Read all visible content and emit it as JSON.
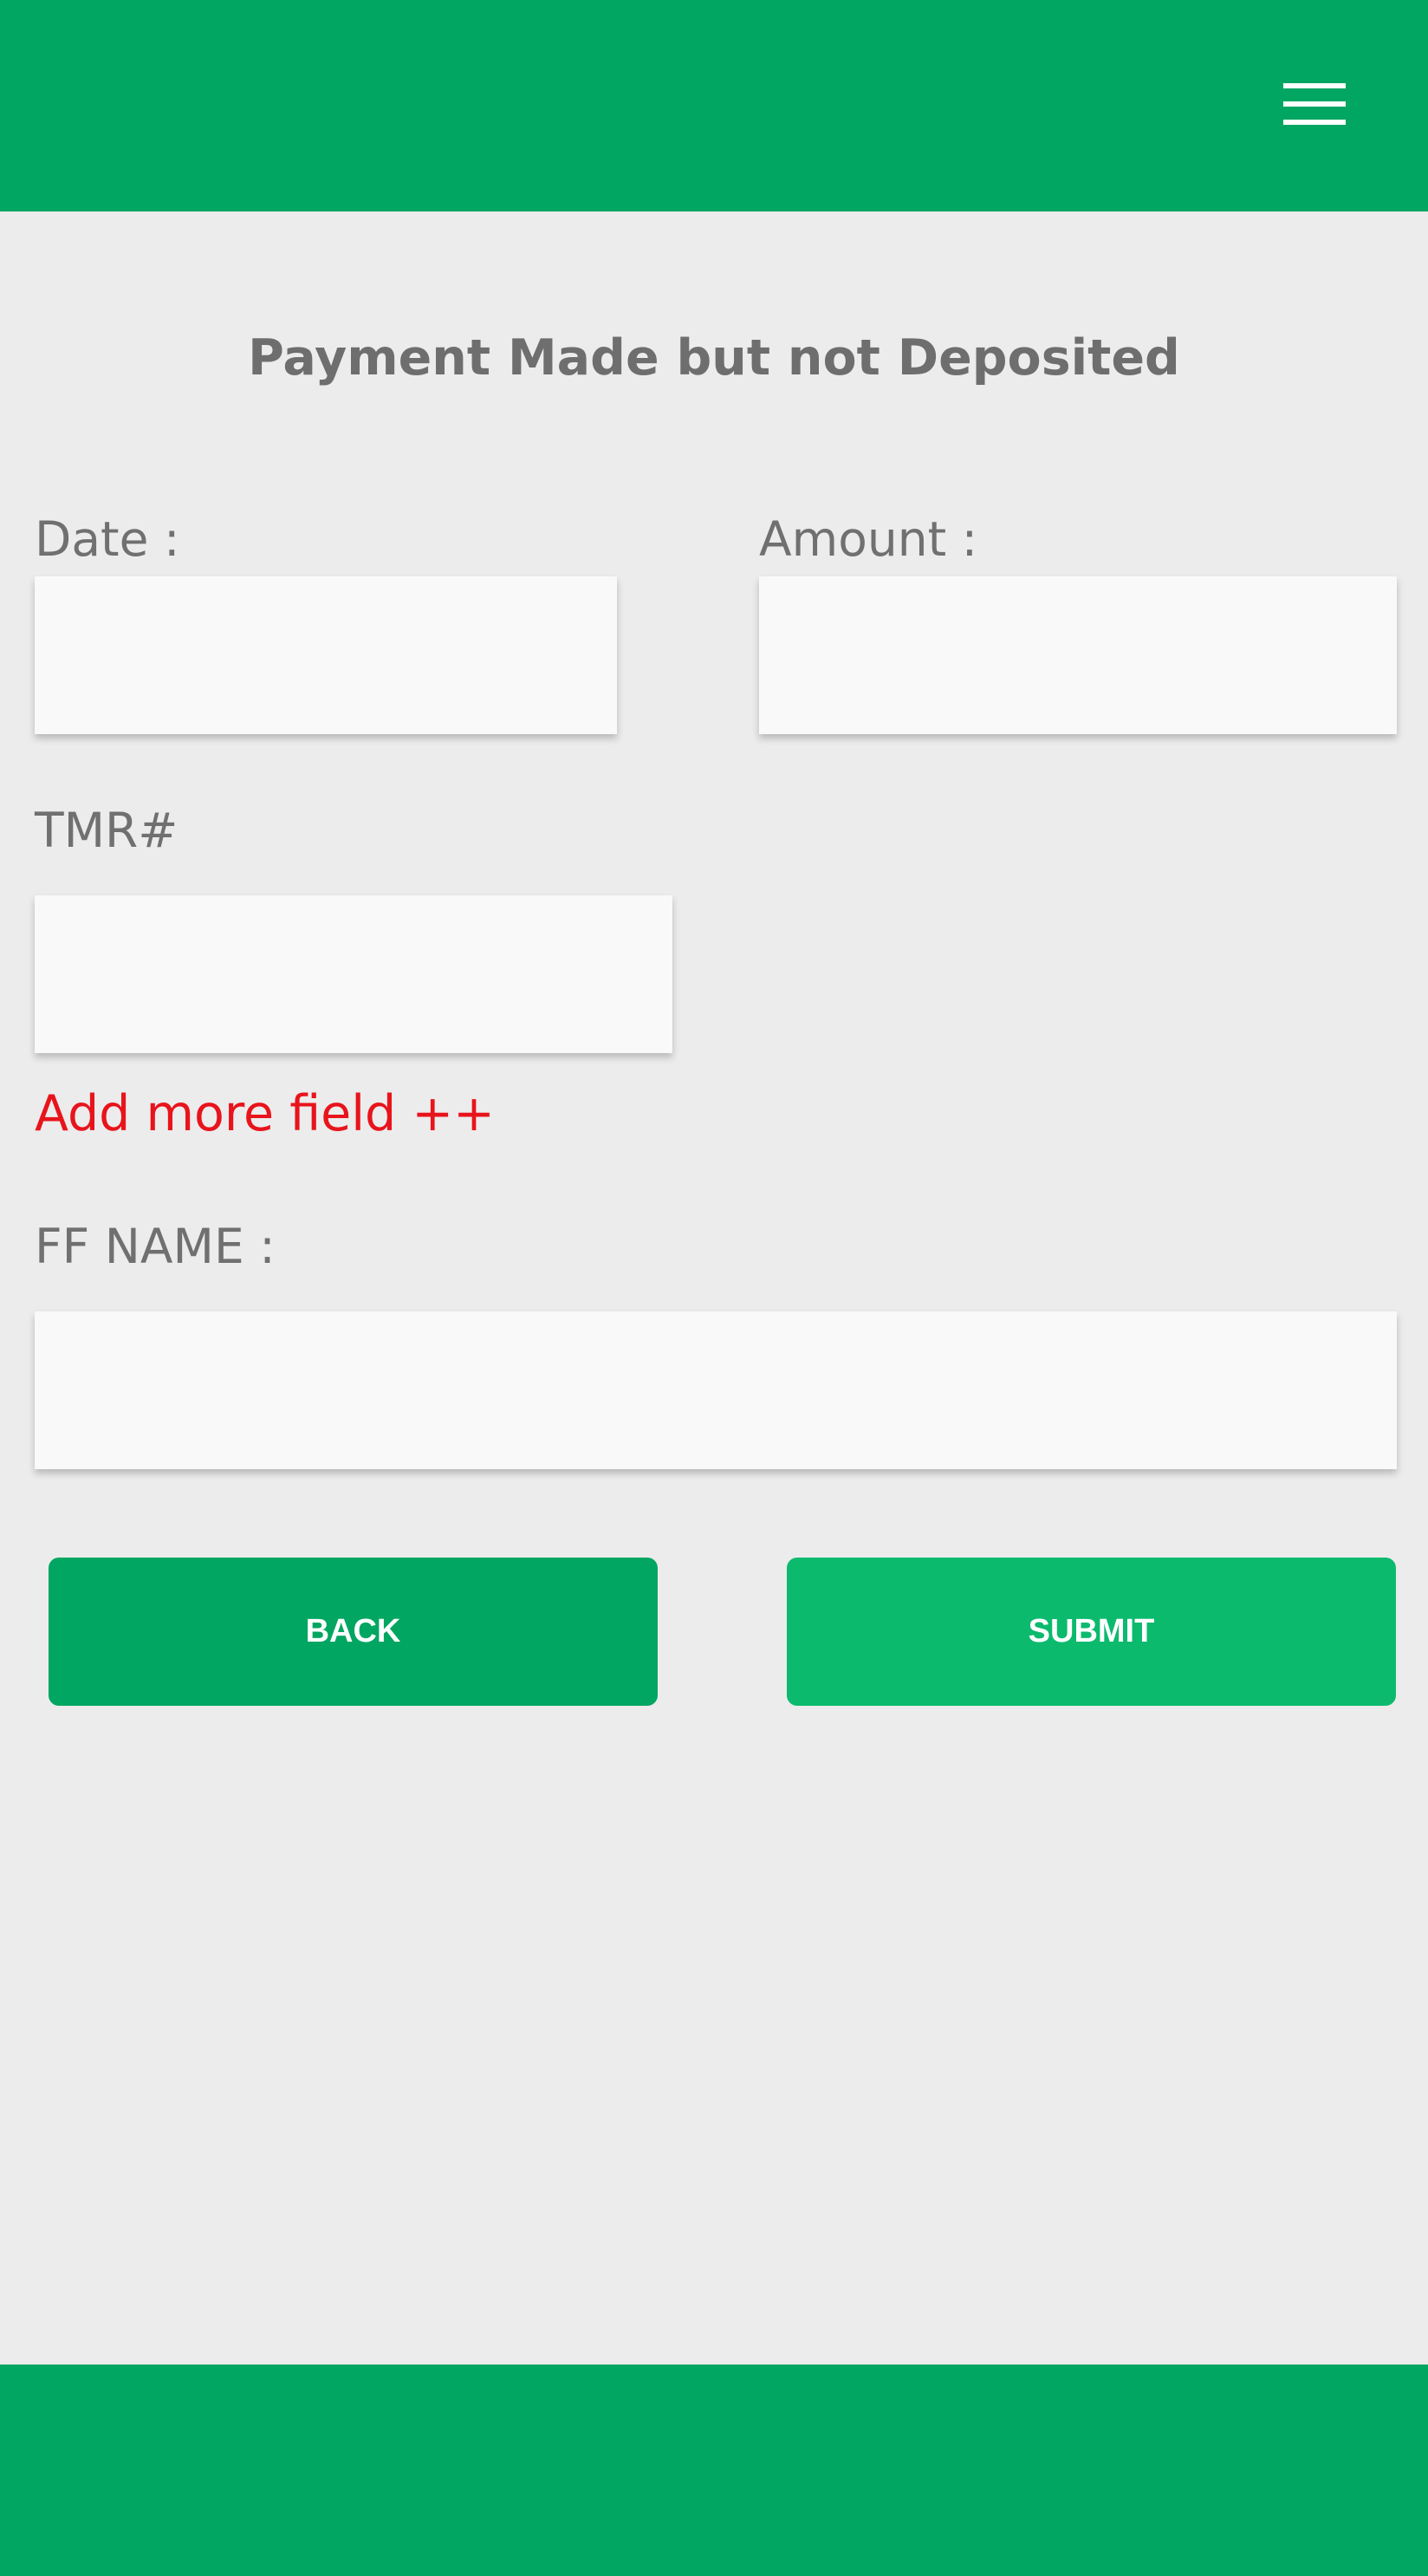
{
  "colors": {
    "primary": "#00a661",
    "submit": "#0cba6e",
    "background": "#ececec",
    "field": "#f9f9f9",
    "link": "#e8141c",
    "label": "#707070"
  },
  "header": {
    "menu_icon": "hamburger-menu-icon"
  },
  "form": {
    "title": "Payment Made but not Deposited",
    "date": {
      "label": "Date :",
      "value": ""
    },
    "amount": {
      "label": "Amount :",
      "value": ""
    },
    "tmr": {
      "label": "TMR#",
      "value": ""
    },
    "add_more_label": "Add more field ++",
    "ff_name": {
      "label": "FF NAME :",
      "value": ""
    }
  },
  "buttons": {
    "back_label": "BACK",
    "submit_label": "SUBMIT"
  }
}
